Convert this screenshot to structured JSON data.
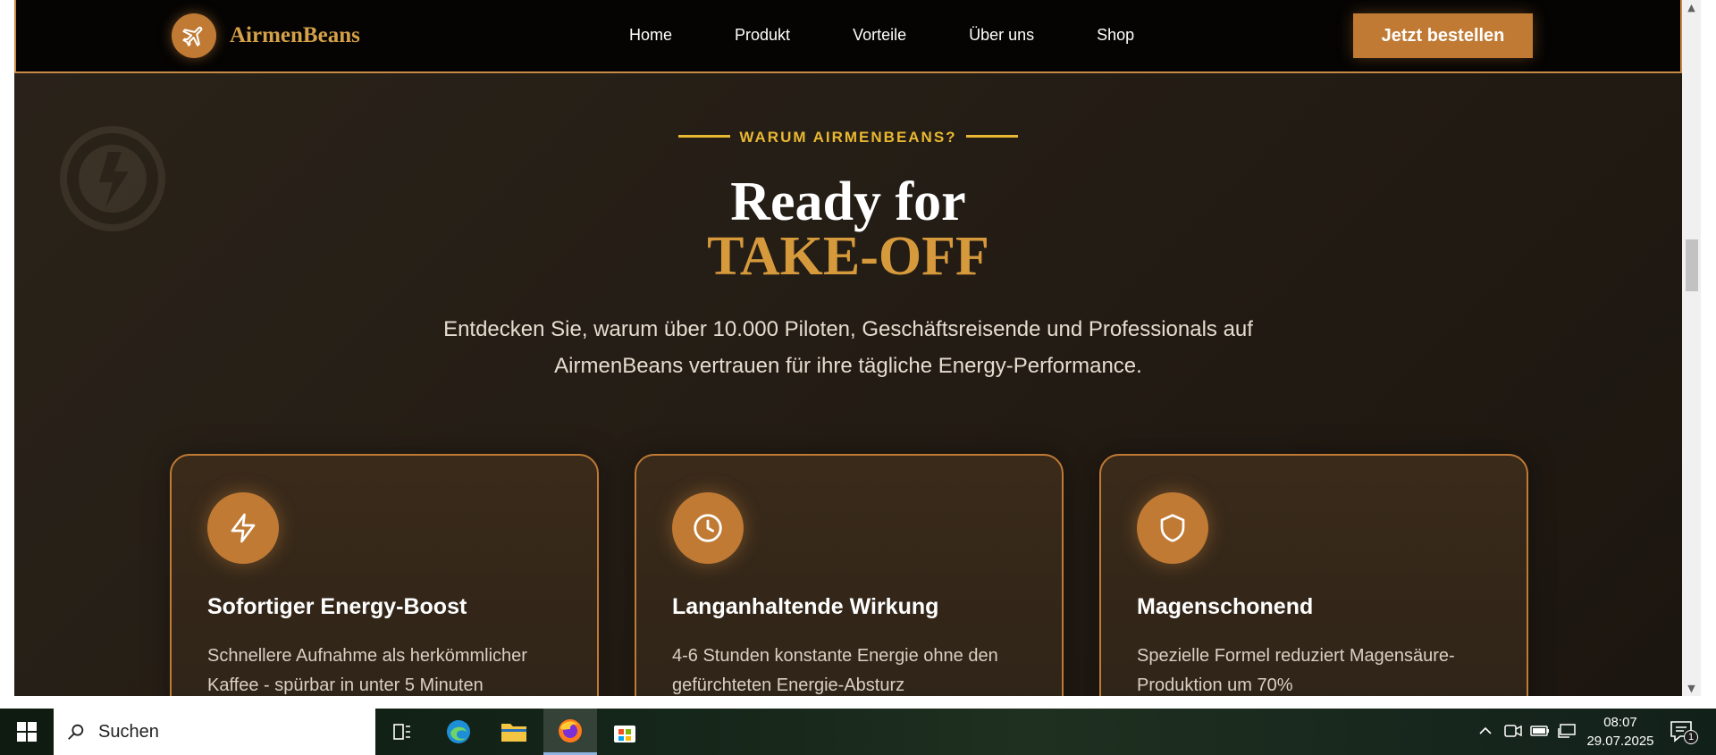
{
  "header": {
    "logo_text": "AirmenBeans",
    "nav": [
      "Home",
      "Produkt",
      "Vorteile",
      "Über uns",
      "Shop"
    ],
    "cta_label": "Jetzt bestellen"
  },
  "section": {
    "eyebrow": "WARUM AIRMENBEANS?",
    "headline_line1": "Ready for",
    "headline_line2": "TAKE-OFF",
    "lead": "Entdecken Sie, warum über 10.000 Piloten, Geschäftsreisende und Professionals auf AirmenBeans vertrauen für ihre tägliche Energy-Performance."
  },
  "cards": [
    {
      "icon": "lightning-icon",
      "title": "Sofortiger Energy-Boost",
      "text": "Schnellere Aufnahme als herkömmlicher Kaffee - spürbar in unter 5 Minuten"
    },
    {
      "icon": "clock-icon",
      "title": "Langanhaltende Wirkung",
      "text": "4-6 Stunden konstante Energie ohne den gefürchteten Energie-Absturz"
    },
    {
      "icon": "shield-icon",
      "title": "Magenschonend",
      "text": "Spezielle Formel reduziert Magensäure-Produktion um 70%"
    }
  ],
  "taskbar": {
    "search_placeholder": "Suchen",
    "time": "08:07",
    "date": "29.07.2025",
    "notification_count": "1"
  },
  "colors": {
    "accent": "#c07a34",
    "gold": "#d69a3c",
    "eyebrow": "#e9b832"
  }
}
